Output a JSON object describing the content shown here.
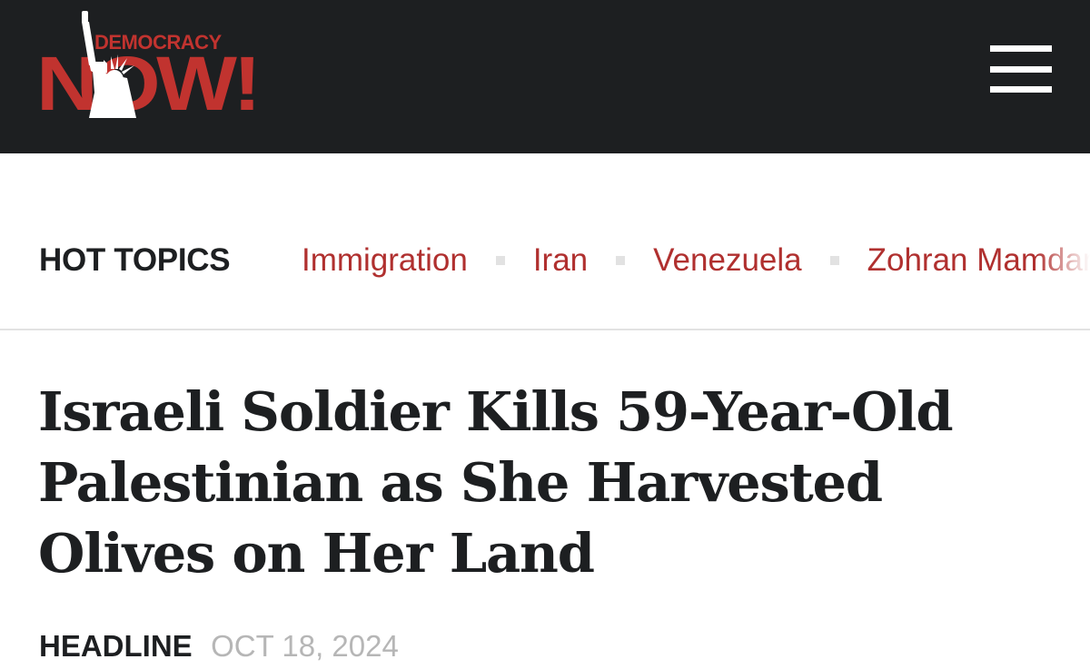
{
  "brand": {
    "logo_top": "DEMOCRACY",
    "logo_main": "NOW!",
    "logo_red": "#c1332f",
    "header_bg": "#1d1f21"
  },
  "header": {
    "menu_icon": "hamburger-menu-icon"
  },
  "hot_topics": {
    "label": "HOT TOPICS",
    "items": [
      "Immigration",
      "Iran",
      "Venezuela",
      "Zohran Mamdani"
    ],
    "link_color": "#b0302f"
  },
  "article": {
    "title": "Israeli Soldier Kills 59-Year-Old Palestinian as She Harvested Olives on Her Land",
    "type": "HEADLINE",
    "date": "OCT 18, 2024"
  }
}
